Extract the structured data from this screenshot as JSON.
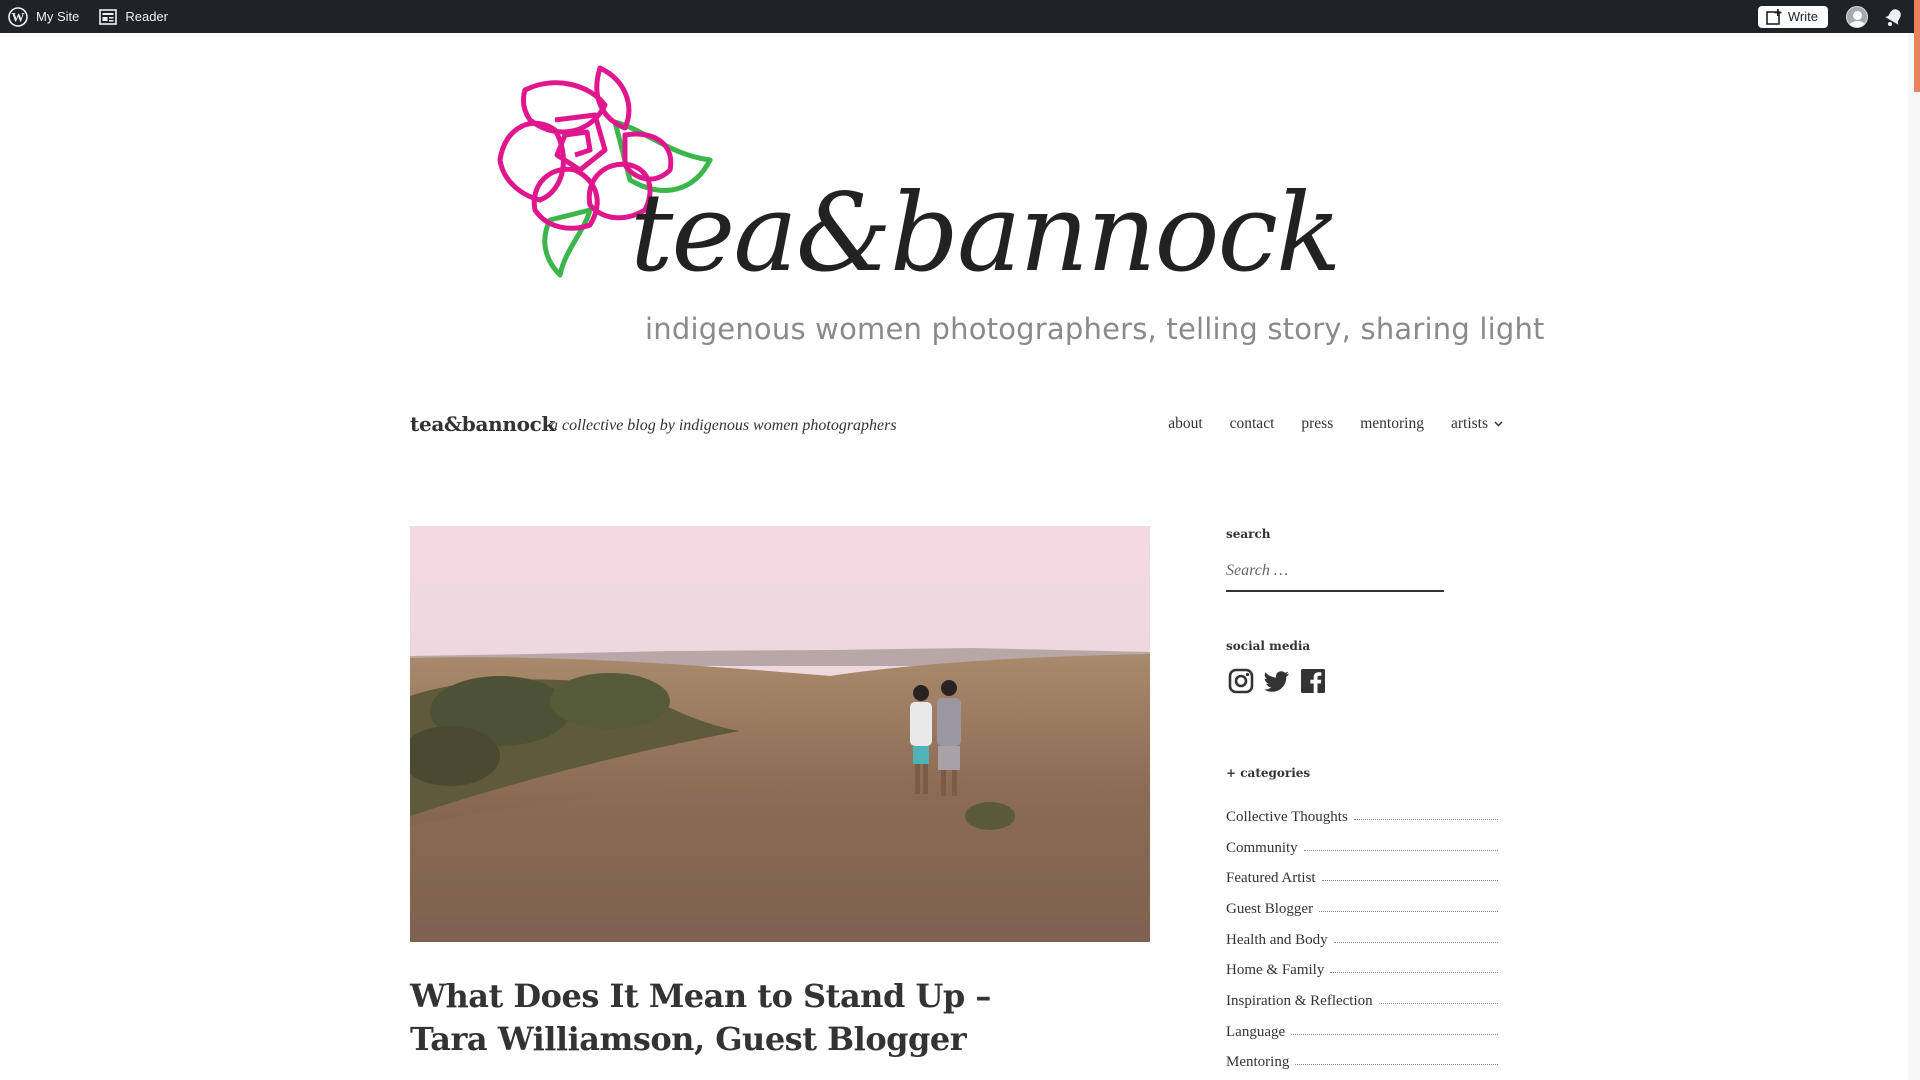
{
  "admin_bar": {
    "my_site": "My Site",
    "reader": "Reader",
    "write": "Write"
  },
  "header": {
    "logo_word": "tea&bannock",
    "logo_tagline": "indigenous women photographers, telling story, sharing light"
  },
  "site": {
    "title": "tea&bannock",
    "description": "a collective blog by indigenous women photographers"
  },
  "nav": {
    "items": [
      {
        "label": "about"
      },
      {
        "label": "contact"
      },
      {
        "label": "press"
      },
      {
        "label": "mentoring"
      },
      {
        "label": "artists"
      }
    ]
  },
  "post": {
    "title": "What Does It Mean to Stand Up – Tara Williamson, Guest Blogger"
  },
  "sidebar": {
    "search": {
      "title": "search",
      "placeholder": "Search …"
    },
    "social": {
      "title": "social media",
      "icons": [
        "instagram-icon",
        "twitter-icon",
        "facebook-icon"
      ]
    },
    "categories": {
      "title": "+ categories",
      "items": [
        {
          "label": "Collective Thoughts"
        },
        {
          "label": "Community"
        },
        {
          "label": "Featured Artist"
        },
        {
          "label": "Guest Blogger"
        },
        {
          "label": "Health and Body"
        },
        {
          "label": "Home & Family"
        },
        {
          "label": "Inspiration & Reflection"
        },
        {
          "label": "Language"
        },
        {
          "label": "Mentoring"
        }
      ]
    }
  },
  "colors": {
    "admin_bar": "#1d2327",
    "rose": "#e0168f",
    "leaf": "#3cb54a",
    "text": "#333333",
    "tagline": "#8a8a8a",
    "scroll_accent": "#e8825c"
  }
}
